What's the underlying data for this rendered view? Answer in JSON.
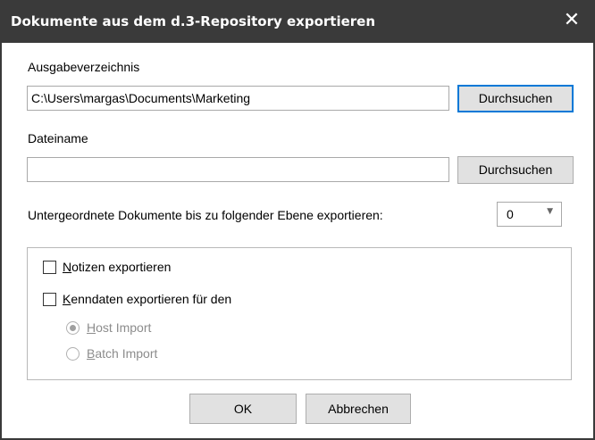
{
  "dialog": {
    "title": "Dokumente aus dem d.3-Repository exportieren",
    "close_symbol": "✕"
  },
  "output_dir": {
    "label": "Ausgabeverzeichnis",
    "value": "C:\\Users\\margas\\Documents\\Marketing",
    "browse_label": "Durchsuchen"
  },
  "filename": {
    "label": "Dateiname",
    "value": "",
    "browse_label": "Durchsuchen"
  },
  "sublevel": {
    "label": "Untergeordnete Dokumente bis zu folgender Ebene exportieren:",
    "value": "0"
  },
  "options": {
    "notes_label": "Notizen exportieren",
    "notes_checked": false,
    "keydata_label": "Kenndaten exportieren für den",
    "keydata_checked": false,
    "host_import_label": "Host Import",
    "host_import_selected": true,
    "batch_import_label": "Batch Import",
    "batch_import_selected": false
  },
  "buttons": {
    "ok_label": "OK",
    "cancel_label": "Abbrechen"
  },
  "colors": {
    "titlebar": "#3a3a3a",
    "default_button_border": "#0078d7"
  }
}
